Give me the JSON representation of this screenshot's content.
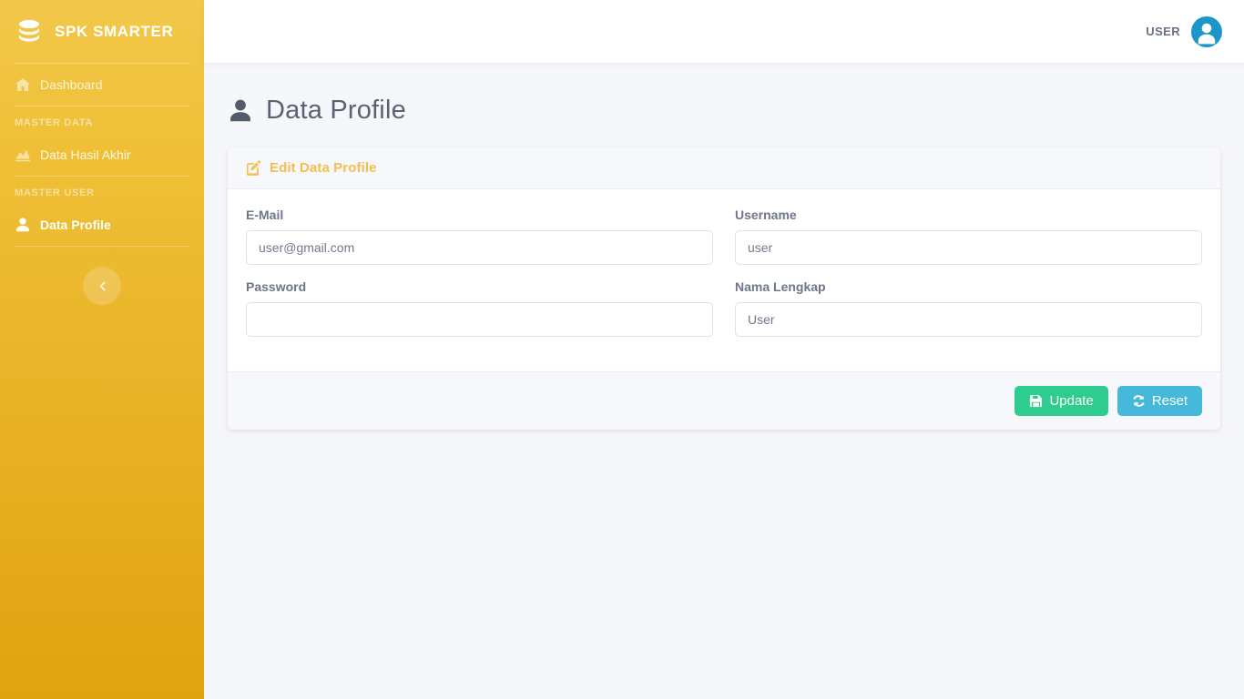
{
  "brand": {
    "name": "SPK SMARTER",
    "logo_icon": "database-icon"
  },
  "sidebar": {
    "items": [
      {
        "label": "Dashboard",
        "icon": "home-icon",
        "state": "dim"
      }
    ],
    "sections": [
      {
        "label": "MASTER DATA",
        "items": [
          {
            "label": "Data Hasil Akhir",
            "icon": "chart-area-icon",
            "state": "semi"
          }
        ]
      },
      {
        "label": "MASTER USER",
        "items": [
          {
            "label": "Data Profile",
            "icon": "user-icon",
            "state": "active"
          }
        ]
      }
    ],
    "collapse": {
      "icon": "chevron-left-icon"
    }
  },
  "topbar": {
    "user_label": "USER",
    "avatar_icon": "user-avatar-icon"
  },
  "page": {
    "title": "Data Profile",
    "title_icon": "user-icon"
  },
  "card": {
    "header": {
      "title": "Edit Data Profile",
      "icon": "edit-pencil-square-icon"
    },
    "fields": [
      {
        "label": "E-Mail",
        "value": "user@gmail.com",
        "placeholder": "user@gmail.com",
        "type": "email",
        "name": "email-field"
      },
      {
        "label": "Username",
        "value": "user",
        "placeholder": "user",
        "type": "text",
        "name": "username-field"
      },
      {
        "label": "Password",
        "value": "",
        "placeholder": "",
        "type": "password",
        "name": "password-field"
      },
      {
        "label": "Nama Lengkap",
        "value": "User",
        "placeholder": "User",
        "type": "text",
        "name": "nama-lengkap-field"
      }
    ],
    "footer": {
      "update_label": "Update",
      "update_icon": "save-icon",
      "reset_label": "Reset",
      "reset_icon": "sync-icon"
    }
  },
  "colors": {
    "sidebar_top": "#F2C84B",
    "sidebar_bottom": "#E0A30F",
    "accent": "#F5BE4D",
    "update_green": "#2ECC8F",
    "reset_blue": "#46B8DA",
    "avatar_blue": "#1C96C8",
    "page_bg": "#F6F7FB"
  }
}
